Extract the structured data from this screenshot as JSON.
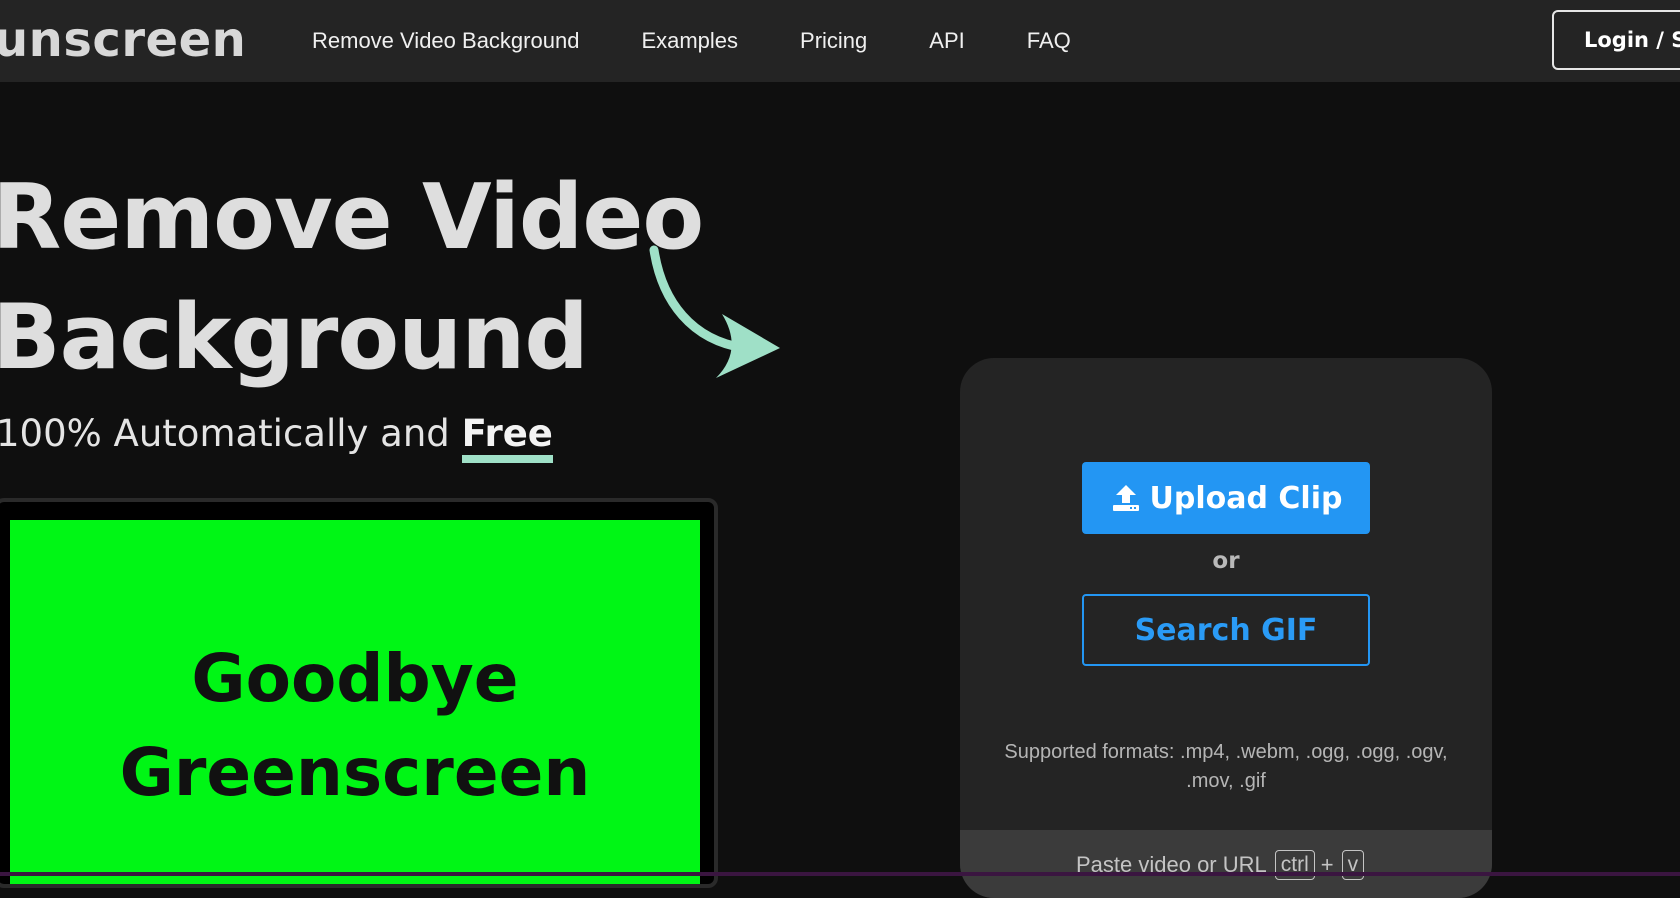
{
  "nav": {
    "logo": "unscreen",
    "links": [
      "Remove Video Background",
      "Examples",
      "Pricing",
      "API",
      "FAQ"
    ],
    "login_label": "Login / Sign up"
  },
  "hero": {
    "title_line1": "Remove Video",
    "title_line2": "Background",
    "subtitle_prefix": "100% Automatically and ",
    "subtitle_emphasis": "Free"
  },
  "preview": {
    "line1": "Goodbye",
    "line2": "Greenscreen"
  },
  "upload": {
    "upload_label": "Upload Clip",
    "or_label": "or",
    "gif_label": "Search GIF",
    "formats_line1": "Supported formats: .mp4, .webm, .ogg, .ogg, .ogv,",
    "formats_line2": ".mov, .gif",
    "paste_label": "Paste video or URL",
    "key1": "ctrl",
    "plus": "+",
    "key2": "v"
  },
  "colors": {
    "accent_blue": "#2396f3",
    "mint": "#9fe0c7",
    "green_screen": "#00f615"
  }
}
